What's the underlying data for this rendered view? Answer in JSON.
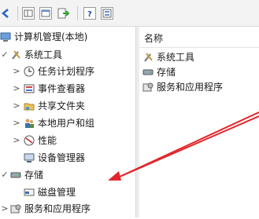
{
  "toolbar": {
    "buttons": [
      "back-icon",
      "forward-icon",
      "show-hide-tree-icon",
      "export-icon",
      "help-icon",
      "properties-icon"
    ]
  },
  "tree": {
    "root": "计算机管理(本地)",
    "system_tools": "系统工具",
    "task_scheduler": "任务计划程序",
    "event_viewer": "事件查看器",
    "shared_folders": "共享文件夹",
    "local_users": "本地用户和组",
    "performance": "性能",
    "device_manager": "设备管理器",
    "storage": "存储",
    "disk_management": "磁盘管理",
    "services_apps": "服务和应用程序"
  },
  "right_pane": {
    "column_name": "名称",
    "items": [
      "系统工具",
      "存储",
      "服务和应用程序"
    ]
  },
  "colors": {
    "annotation_arrow": "#e2262b",
    "toolbar_bg": "#f3f3f3"
  }
}
